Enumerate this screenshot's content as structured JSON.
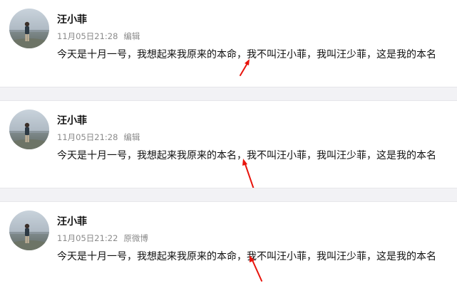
{
  "colors": {
    "divider": "#f2f2f5",
    "meta_text": "#8a8a8a",
    "arrow": "#e8140c"
  },
  "posts": [
    {
      "username": "汪小菲",
      "timestamp": "11月05日21:28",
      "source": "编辑",
      "content": "今天是十月一号，我想起来我原来的本命，我不叫汪小菲，我叫汪少菲，这是我的本名",
      "annotation": "red-arrow"
    },
    {
      "username": "汪小菲",
      "timestamp": "11月05日21:28",
      "source": "编辑",
      "content": "今天是十月一号，我想起来我原来的本名，我不叫汪小菲，我叫汪少菲，这是我的本名",
      "annotation": "red-arrow"
    },
    {
      "username": "汪小菲",
      "timestamp": "11月05日21:22",
      "source": "原微博",
      "content": "今天是十月一号，我想起来我原来的本命，我不叫汪小菲，我叫汪少菲，这是我的本名",
      "annotation": "red-arrow"
    }
  ]
}
